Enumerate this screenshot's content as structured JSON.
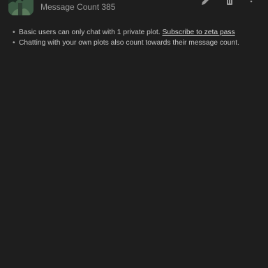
{
  "header": {
    "message_count": "Message Count 385",
    "icons": {
      "avatar": "character-avatar",
      "edit": "pencil-icon",
      "delete": "trash-icon",
      "more": "more-vertical-icon"
    }
  },
  "notes": {
    "item1_text": "Basic users can only chat with 1 private plot.",
    "item1_link": "Subscribe to zeta pass",
    "item2_text": "Chatting with your own plots also count towards their message count."
  },
  "colors": {
    "background": "#1e1e1e",
    "text": "#c4c4c4",
    "muted": "#9a9a9a"
  }
}
